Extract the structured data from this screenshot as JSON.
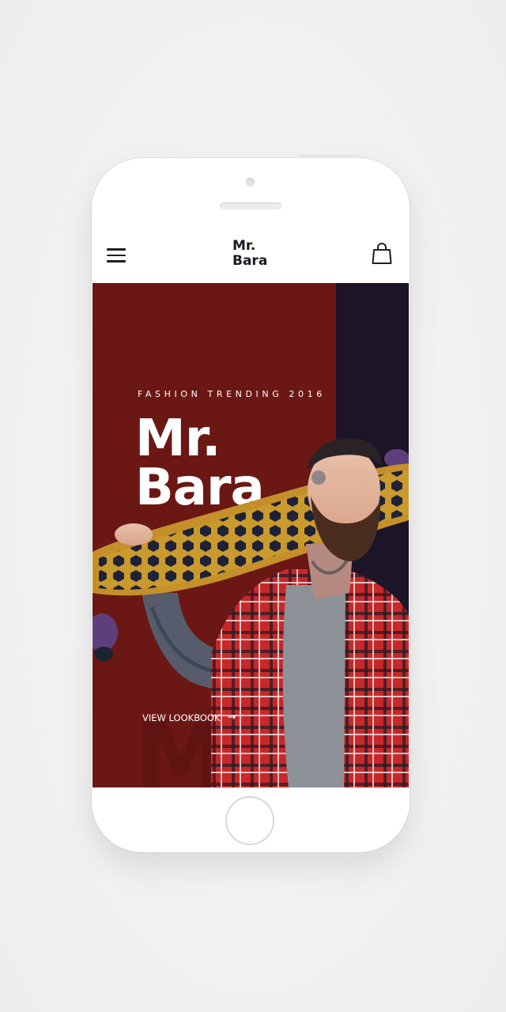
{
  "app": {
    "logo_line1": "Mr.",
    "logo_line2": "Bara"
  },
  "header": {
    "menu_icon": "hamburger-menu-icon",
    "cart_icon": "shopping-bag-icon"
  },
  "hero": {
    "eyebrow": "FASHION TRENDING 2016",
    "title_line1": "Mr.",
    "title_line2": "Bara",
    "cta_label": "VIEW LOOKBOOK",
    "cta_icon": "arrow-right-icon",
    "watermark": "Mr"
  },
  "colors": {
    "hero_background": "#6b1714",
    "hero_dark_strip": "#1c1528",
    "header_background": "#ffffff",
    "page_background": "#f2f2f2"
  }
}
